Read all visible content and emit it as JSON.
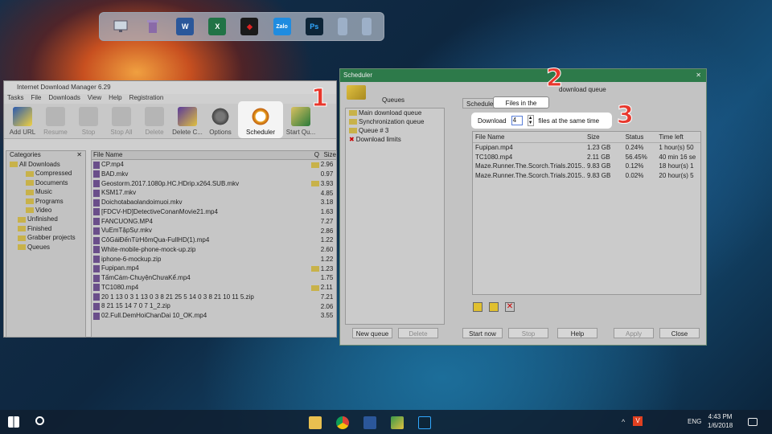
{
  "dock": {
    "icons": [
      "monitor-icon",
      "trash-icon",
      "word-icon",
      "excel-icon",
      "garena-icon",
      "zalo-icon",
      "photoshop-icon",
      "doc-icon",
      "doc-icon"
    ],
    "labels": {
      "word": "W",
      "excel": "X",
      "zalo": "Zalo",
      "ps": "Ps"
    }
  },
  "idm": {
    "title": "Internet Download Manager 6.29",
    "menu": [
      "Tasks",
      "File",
      "Downloads",
      "View",
      "Help",
      "Registration"
    ],
    "toolbar": [
      {
        "label": "Add URL",
        "enabled": true
      },
      {
        "label": "Resume",
        "enabled": false
      },
      {
        "label": "Stop",
        "enabled": false
      },
      {
        "label": "Stop All",
        "enabled": false
      },
      {
        "label": "Delete",
        "enabled": false
      },
      {
        "label": "Delete C...",
        "enabled": true
      },
      {
        "label": "Options",
        "enabled": true
      },
      {
        "label": "Scheduler",
        "enabled": true
      },
      {
        "label": "Start Qu...",
        "enabled": true
      }
    ],
    "categories_header": "Categories",
    "categories": [
      {
        "label": "All Downloads",
        "indent": 0
      },
      {
        "label": "Compressed",
        "indent": 2
      },
      {
        "label": "Documents",
        "indent": 2
      },
      {
        "label": "Music",
        "indent": 2
      },
      {
        "label": "Programs",
        "indent": 2
      },
      {
        "label": "Video",
        "indent": 2
      },
      {
        "label": "Unfinished",
        "indent": 1
      },
      {
        "label": "Finished",
        "indent": 1
      },
      {
        "label": "Grabber projects",
        "indent": 1
      },
      {
        "label": "Queues",
        "indent": 1
      }
    ],
    "file_cols": [
      "File Name",
      "Q",
      "Size"
    ],
    "files": [
      {
        "name": "CP.mp4",
        "q": true,
        "size": "2.96"
      },
      {
        "name": "BAD.mkv",
        "q": false,
        "size": "0.97"
      },
      {
        "name": "Geostorm.2017.1080p.HC.HDrip.x264.SUB.mkv",
        "q": true,
        "size": "3.93"
      },
      {
        "name": "KSM17.mkv",
        "q": false,
        "size": "4.85"
      },
      {
        "name": "Doichotabaolandoimuoi.mkv",
        "q": false,
        "size": "3.18"
      },
      {
        "name": "[FDCV-HD]DetectiveConanMovie21.mp4",
        "q": false,
        "size": "1.63"
      },
      {
        "name": "FANCUONG.MP4",
        "q": false,
        "size": "7.27"
      },
      {
        "name": "VuEmTậpSự.mkv",
        "q": false,
        "size": "2.86"
      },
      {
        "name": "CôGáiĐếnTừHômQua-FullHD(1).mp4",
        "q": false,
        "size": "1.22"
      },
      {
        "name": "White-mobile-phone-mock-up.zip",
        "q": false,
        "size": "2.60"
      },
      {
        "name": "iphone-6-mockup.zip",
        "q": false,
        "size": "1.22"
      },
      {
        "name": "Fupipan.mp4",
        "q": true,
        "size": "1.23"
      },
      {
        "name": "TấmCám-ChuyệnChưaKể.mp4",
        "q": false,
        "size": "1.75"
      },
      {
        "name": "TC1080.mp4",
        "q": true,
        "size": "2.11"
      },
      {
        "name": "20 1 13 0 3 1 13 0 3 8 21 25 5 14 0 3 8 21 10 11 5.zip",
        "q": false,
        "size": "7.21"
      },
      {
        "name": "8 21 15 14 7 0 7 1_2.zip",
        "q": false,
        "size": "2.06"
      },
      {
        "name": "02.Full.DemHoiChanDai 10_OK.mp4",
        "q": false,
        "size": "3.55"
      }
    ]
  },
  "scheduler": {
    "title": "Scheduler",
    "queues_label": "Queues",
    "queues": [
      "Main download queue",
      "Synchronization queue",
      "Queue # 3",
      "Download limits"
    ],
    "queue_heading": "download queue",
    "tabs": [
      "Schedule",
      "Files in the queue"
    ],
    "download_label": "Download",
    "download_count": "4",
    "files_same_time": "files at the same time",
    "cols": [
      "File Name",
      "Size",
      "Status",
      "Time left"
    ],
    "rows": [
      {
        "name": "Fupipan.mp4",
        "size": "1.23  GB",
        "status": "0.24%",
        "time": "1 hour(s) 50"
      },
      {
        "name": "TC1080.mp4",
        "size": "2.11  GB",
        "status": "56.45%",
        "time": "40 min  16 se"
      },
      {
        "name": "Maze.Runner.The.Scorch.Trials.2015....",
        "size": "9.83  GB",
        "status": "0.12%",
        "time": "18 hour(s) 1"
      },
      {
        "name": "Maze.Runner.The.Scorch.Trials.2015....",
        "size": "9.83  GB",
        "status": "0.02%",
        "time": "20 hour(s) 5"
      }
    ],
    "buttons": {
      "new_queue": "New queue",
      "delete": "Delete",
      "start_now": "Start now",
      "stop": "Stop",
      "help": "Help",
      "apply": "Apply",
      "close": "Close"
    }
  },
  "callouts": [
    "1",
    "2",
    "3"
  ],
  "taskbar": {
    "lang": "ENG",
    "time": "4:43 PM",
    "date": "1/6/2018"
  }
}
